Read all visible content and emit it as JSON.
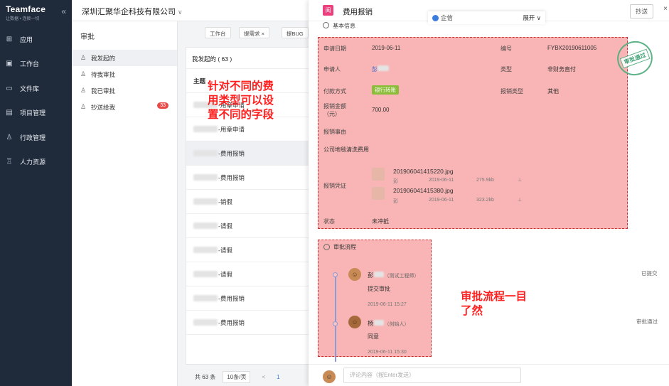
{
  "brand": {
    "name": "Teamface",
    "tagline": "让数据 • 连接一切",
    "collapse_icon": "double-chevron-left-icon"
  },
  "nav": [
    {
      "label": "应用",
      "icon": "apps-icon"
    },
    {
      "label": "工作台",
      "icon": "workbench-icon"
    },
    {
      "label": "文件库",
      "icon": "folder-icon"
    },
    {
      "label": "项目管理",
      "icon": "project-icon"
    },
    {
      "label": "行政管理",
      "icon": "admin-icon"
    },
    {
      "label": "人力资源",
      "icon": "hr-icon"
    }
  ],
  "header": {
    "company": "深圳汇聚华企科技有限公司"
  },
  "subnav": {
    "title": "审批",
    "items": [
      {
        "label": "我发起的",
        "active": true
      },
      {
        "label": "待我审批"
      },
      {
        "label": "我已审批"
      },
      {
        "label": "抄送给我",
        "badge": "33"
      }
    ]
  },
  "tabs": [
    {
      "label": "工作台"
    },
    {
      "label": "提需求"
    },
    {
      "label": "提BUG"
    }
  ],
  "list": {
    "header": "我发起的 ( 63 )",
    "column_head": "主题",
    "rows": [
      "-用章申请",
      "-用章申请",
      "-费用报销",
      "-费用报销",
      "-销假",
      "-请假",
      "-请假",
      "-请假",
      "-费用报销",
      "-费用报销"
    ]
  },
  "pager": {
    "total": "共 63 条",
    "size": "10条/页",
    "prev": "<",
    "page": "1"
  },
  "detail": {
    "icon_text": "阅",
    "title": "费用报销",
    "cc_button": "抄送",
    "close": "×",
    "section_basic": "基本信息",
    "fields": {
      "apply_date_label": "申请日期",
      "apply_date": "2019-06-11",
      "number_label": "编号",
      "number": "FYBX20190611005",
      "applicant_label": "申请人",
      "applicant": "彭",
      "type_label": "类型",
      "type": "非财务直付",
      "pay_label": "付款方式",
      "pay": "银行转账",
      "reimb_type_label": "报销类型",
      "reimb_type": "其他",
      "amount_label": "报销金额\n（元）",
      "amount": "700.00",
      "reason_label": "报销事由",
      "reason": "公司地毯清洗费用",
      "voucher_label": "报销凭证",
      "files": [
        {
          "name": "201906041415220.jpg",
          "user": "彭",
          "date": "2019-06-11",
          "size": "275.9kb"
        },
        {
          "name": "201906041415380.jpg",
          "user": "彭",
          "date": "2019-06-11",
          "size": "323.2kb"
        }
      ],
      "status_label": "状态",
      "status": "未冲抵"
    },
    "stamp": "审批通过",
    "flow_title": "审批流程",
    "flow": [
      {
        "name": "彭",
        "role": "（测试工程师）",
        "action": "提交审批",
        "time": "2019-06-11 15:27",
        "state": "已提交"
      },
      {
        "name": "杨",
        "role": "（创始人）",
        "action": "同意",
        "time": "2019-06-11 15:30",
        "state": "审批通过"
      }
    ],
    "comment_placeholder": "评论内容（按Enter发送）",
    "qiye": "企信",
    "qiye_expand": "展开"
  },
  "callouts": {
    "fields": "针对不同的费\n用类型可以设\n置不同的字段",
    "flow": "审批流程一目\n了然"
  }
}
